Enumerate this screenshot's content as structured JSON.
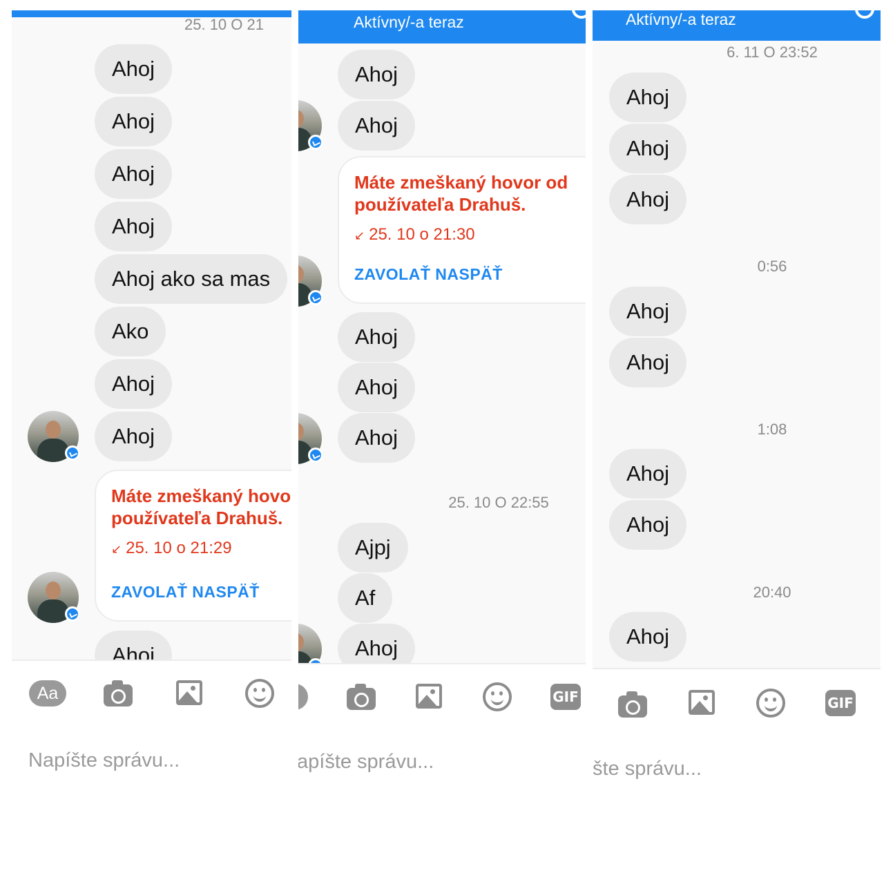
{
  "panel1": {
    "date_stamp": "25. 10 O 21",
    "messages": [
      "Ahoj",
      "Ahoj",
      "Ahoj",
      "Ahoj",
      "Ahoj ako sa mas",
      "Ako",
      "Ahoj",
      "Ahoj"
    ],
    "missed_call": {
      "title": "Máte zmeškaný hovor od používateľa Drahuš.",
      "time": "25. 10 o 21:29",
      "action": "ZAVOLAŤ NASPÄŤ"
    },
    "last_message": "Ahoj",
    "toolbar": {
      "aa_label": "Aa"
    },
    "compose_placeholder": "Napíšte správu..."
  },
  "panel2": {
    "header_status": "Aktívny/-a teraz",
    "messages_top": [
      "Ahoj",
      "Ahoj"
    ],
    "missed_call": {
      "title": "Máte zmeškaný hovor od používateľa Drahuš.",
      "time": "25. 10 o 21:30",
      "action": "ZAVOLAŤ NASPÄŤ"
    },
    "messages_mid": [
      "Ahoj",
      "Ahoj",
      "Ahoj"
    ],
    "date_stamp": "25. 10 O 22:55",
    "messages_bottom": [
      "Ajpj",
      "Af",
      "Ahoj"
    ],
    "toolbar": {
      "aa_label": "a",
      "gif_label": "GIF"
    },
    "compose_placeholder": "apíšte správu..."
  },
  "panel3": {
    "header_status": "Aktívny/-a teraz",
    "date_stamp": "6. 11 O 23:52",
    "group1": [
      "Ahoj",
      "Ahoj",
      "Ahoj"
    ],
    "time2": "0:56",
    "group2": [
      "Ahoj",
      "Ahoj"
    ],
    "time3": "1:08",
    "group3": [
      "Ahoj",
      "Ahoj"
    ],
    "time4": "20:40",
    "group4": [
      "Ahoj"
    ],
    "toolbar": {
      "gif_label": "GIF"
    },
    "compose_placeholder": "šte správu..."
  }
}
